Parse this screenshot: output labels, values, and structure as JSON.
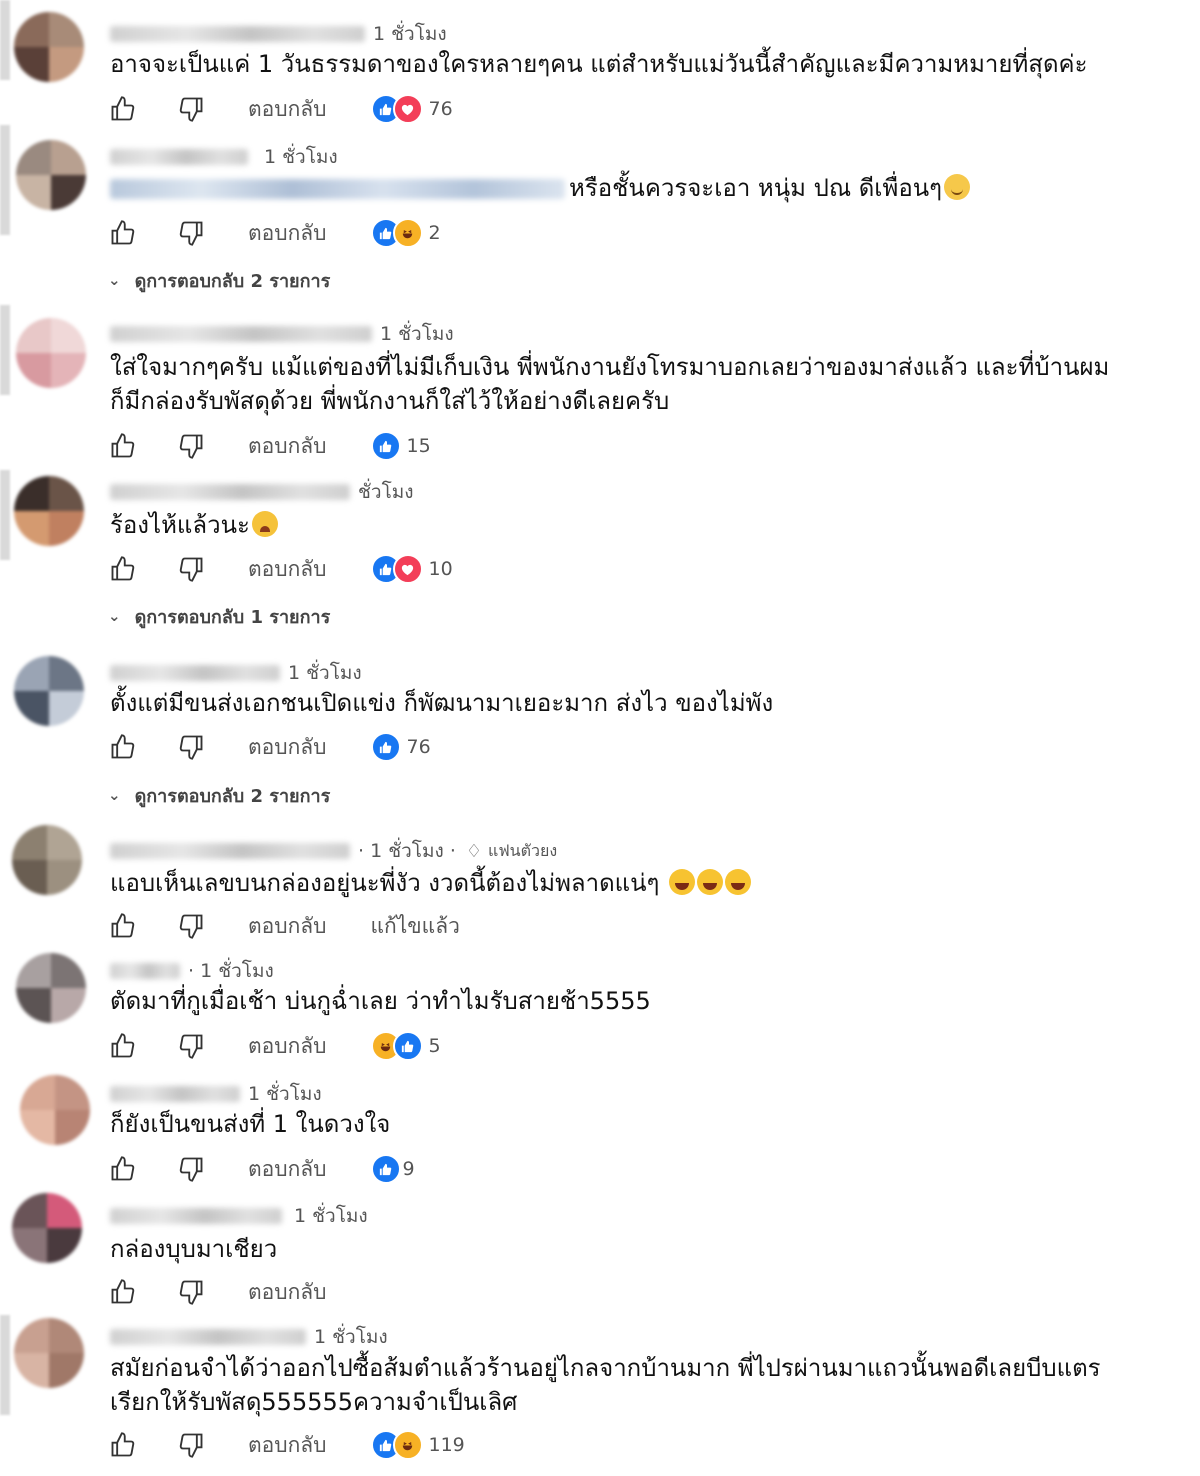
{
  "labels": {
    "reply": "ตอบกลับ"
  },
  "comments": [
    {
      "time": "1 ชั่วโมง",
      "text": "อาจจะเป็นแค่ 1 วันธรรมดาของใครหลายๆคน แต่สำหรับแม่วันนี้สำคัญและมีความหมายที่สุดค่ะ",
      "reactions": [
        "like",
        "love"
      ],
      "count": "76"
    },
    {
      "time": "1 ชั่วโมง",
      "text": "หรือชั้นควรจะเอา หนุ่ม ปณ ดีเพื่อนๆ",
      "reactions": [
        "like",
        "haha"
      ],
      "count": "2",
      "replies": "ดูการตอบกลับ 2 รายการ"
    },
    {
      "time": "1 ชั่วโมง",
      "text_line1": "ใส่ใจมากๆครับ แม้แต่ของที่ไม่มีเก็บเงิน พี่พนักงานยังโทรมาบอกเลยว่าของมาส่งแล้ว และที่บ้านผม",
      "text_line2": "ก็มีกล่องรับพัสดุด้วย พี่พนักงานก็ใส่ไว้ให้อย่างดีเลยครับ",
      "reactions": [
        "like"
      ],
      "count": "15"
    },
    {
      "time": "ชั่วโมง",
      "text": "ร้องไห้แล้วนะ",
      "reactions": [
        "like",
        "love"
      ],
      "count": "10",
      "replies": "ดูการตอบกลับ 1 รายการ"
    },
    {
      "time": "1 ชั่วโมง",
      "text": "ตั้งแต่มีขนส่งเอกชนเปิดแข่ง ก็พัฒนามาเยอะมาก ส่งไว ของไม่พัง",
      "reactions": [
        "like"
      ],
      "count": "76",
      "replies": "ดูการตอบกลับ 2 รายการ"
    },
    {
      "time": "· 1 ชั่วโมง ·",
      "badge": "แฟนตัวยง",
      "text": "แอบเห็นเลขบนกล่องอยู่นะพี่งัว งวดนี้ต้องไม่พลาดแน่ๆ",
      "edited": "แก้ไขแล้ว"
    },
    {
      "time": "· 1 ชั่วโมง",
      "text": "ตัดมาที่กูเมื่อเช้า บ่นกูฉ่ำเลย ว่าทำไมรับสายช้า5555",
      "reactions": [
        "haha",
        "like"
      ],
      "count": "5"
    },
    {
      "time": "1 ชั่วโมง",
      "text": "ก็ยังเป็นขนส่งที่ 1 ในดวงใจ",
      "reactions": [
        "like"
      ],
      "count": "9"
    },
    {
      "time": "1 ชั่วโมง",
      "text": "กล่องบุบมาเชียว"
    },
    {
      "time": "1 ชั่วโมง",
      "text_line1": "สมัยก่อนจำได้ว่าออกไปซื้อส้มตำแล้วร้านอยู่ไกลจากบ้านมาก พี่ไปรผ่านมาแถวนั้นพอดีเลยบีบแตร",
      "text_line2": "เรียกให้รับพัสดุ555555ความจำเป็นเลิศ",
      "reactions": [
        "like",
        "haha"
      ],
      "count": "119"
    }
  ],
  "colors": {
    "like": "#1877f2",
    "love": "#f33e58",
    "haha": "#f7b125",
    "muted_text": "#555555"
  },
  "icons": [
    "thumbs-up-icon",
    "thumbs-down-icon",
    "chevron-down-icon",
    "gem-icon",
    "laugh-emoji",
    "cry-emoji",
    "smile-emoji"
  ]
}
